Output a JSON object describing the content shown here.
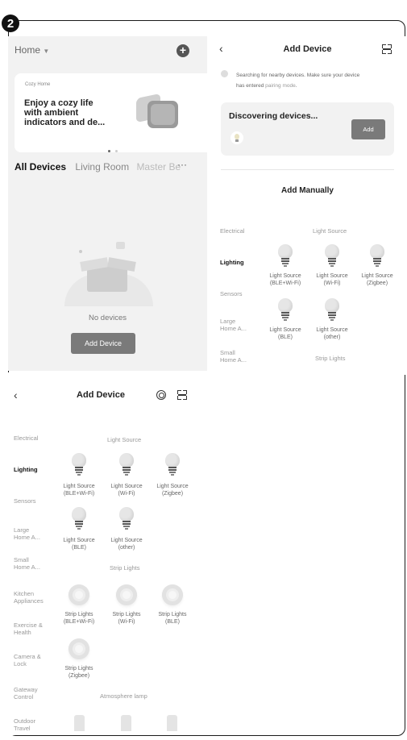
{
  "step_badge": "2",
  "home_screen": {
    "home_label": "Home",
    "banner": {
      "tag": "Cozy Home",
      "title_line1": "Enjoy a cozy life",
      "title_line2": "with ambient",
      "title_line3": "indicators and de..."
    },
    "tabs": [
      "All Devices",
      "Living Room",
      "Master Be"
    ],
    "empty_text": "No devices",
    "add_button": "Add Device"
  },
  "add_device_top": {
    "title": "Add Device",
    "search_note_line1": "Searching for nearby devices. Make sure your device",
    "search_note_line2a": "has entered ",
    "search_note_link": "pairing mode",
    "search_note_line2b": ".",
    "discovering": "Discovering devices...",
    "add_label": "Add",
    "add_manually": "Add Manually",
    "categories": [
      "Electrical",
      "Lighting",
      "Sensors",
      "Large\nHome A...",
      "Small\nHome A..."
    ],
    "section_light_source": "Light Source",
    "section_strip": "Strip Lights",
    "items": [
      "Light Source\n(BLE+Wi-Fi)",
      "Light Source\n(Wi-Fi)",
      "Light Source\n(Zigbee)",
      "Light Source\n(BLE)",
      "Light Source\n(other)"
    ]
  },
  "add_device_bottom": {
    "title": "Add Device",
    "categories": [
      "Electrical",
      "Lighting",
      "Sensors",
      "Large\nHome A...",
      "Small\nHome A...",
      "Kitchen\nAppliances",
      "Exercise &\nHealth",
      "Camera &\nLock",
      "Gateway\nControl",
      "Outdoor\nTravel"
    ],
    "section_light_source": "Light Source",
    "section_strip": "Strip Lights",
    "section_atmosphere": "Atmosphere lamp",
    "light_items": [
      "Light Source\n(BLE+Wi-Fi)",
      "Light Source\n(Wi-Fi)",
      "Light Source\n(Zigbee)",
      "Light Source\n(BLE)",
      "Light Source\n(other)"
    ],
    "strip_items": [
      "Strip Lights\n(BLE+Wi-Fi)",
      "Strip Lights\n(Wi-Fi)",
      "Strip Lights\n(BLE)",
      "Strip Lights\n(Zigbee)"
    ]
  }
}
